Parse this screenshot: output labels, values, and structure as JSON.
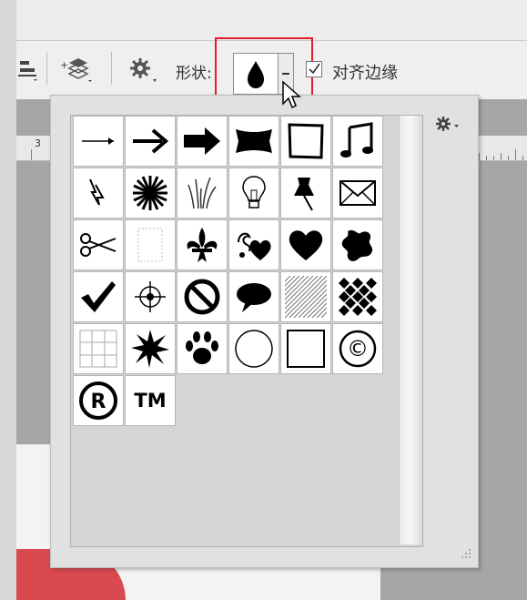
{
  "options_bar": {
    "shape_label": "形状:",
    "align_edges_label": "对齐边缘",
    "align_edges_checked": true,
    "selected_shape": "raindrop"
  },
  "ruler": {
    "visible_label": "3"
  },
  "shape_picker": {
    "shapes": [
      "thin-arrow",
      "bold-arrow",
      "block-arrow",
      "banner-rect",
      "frame",
      "music-notes",
      "lightning",
      "starburst",
      "grass",
      "lightbulb",
      "thumbtack",
      "envelope",
      "scissors",
      "dotted-frame",
      "fleur-de-lis",
      "ornament-heart",
      "heart",
      "puzzle-blob",
      "checkmark",
      "crosshair",
      "no-sign",
      "speech-bubble",
      "diagonal-pattern",
      "checker-pattern",
      "grid",
      "explosion",
      "paw-print",
      "circle-frame",
      "square-frame",
      "copyright",
      "registered",
      "trademark"
    ],
    "copyright_symbol": "©",
    "registered_symbol": "R",
    "trademark_text": "TM"
  },
  "colors": {
    "highlight": "#e21f26",
    "document_red": "#d94a50"
  }
}
